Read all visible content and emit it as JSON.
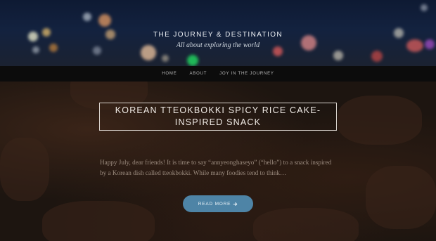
{
  "site": {
    "title": "THE JOURNEY & DESTINATION",
    "tagline": "All about exploring the world"
  },
  "nav": {
    "items": [
      {
        "label": "HOME"
      },
      {
        "label": "ABOUT"
      },
      {
        "label": "JOY IN THE JOURNEY"
      }
    ]
  },
  "post": {
    "title": "KOREAN TTEOKBOKKI SPICY RICE CAKE-INSPIRED SNACK",
    "excerpt": "Happy July, dear friends! It is time to say “annyeonghaseyo” (“hello”) to a snack inspired by a Korean dish called tteokbokki. While many foodies tend to think…",
    "read_more_label": "READ MORE",
    "read_more_icon": "arrow-right-icon"
  },
  "colors": {
    "nav_background": "#0c0c0c",
    "button_accent": "#4e84a6",
    "header_night": "#0e1a33"
  }
}
